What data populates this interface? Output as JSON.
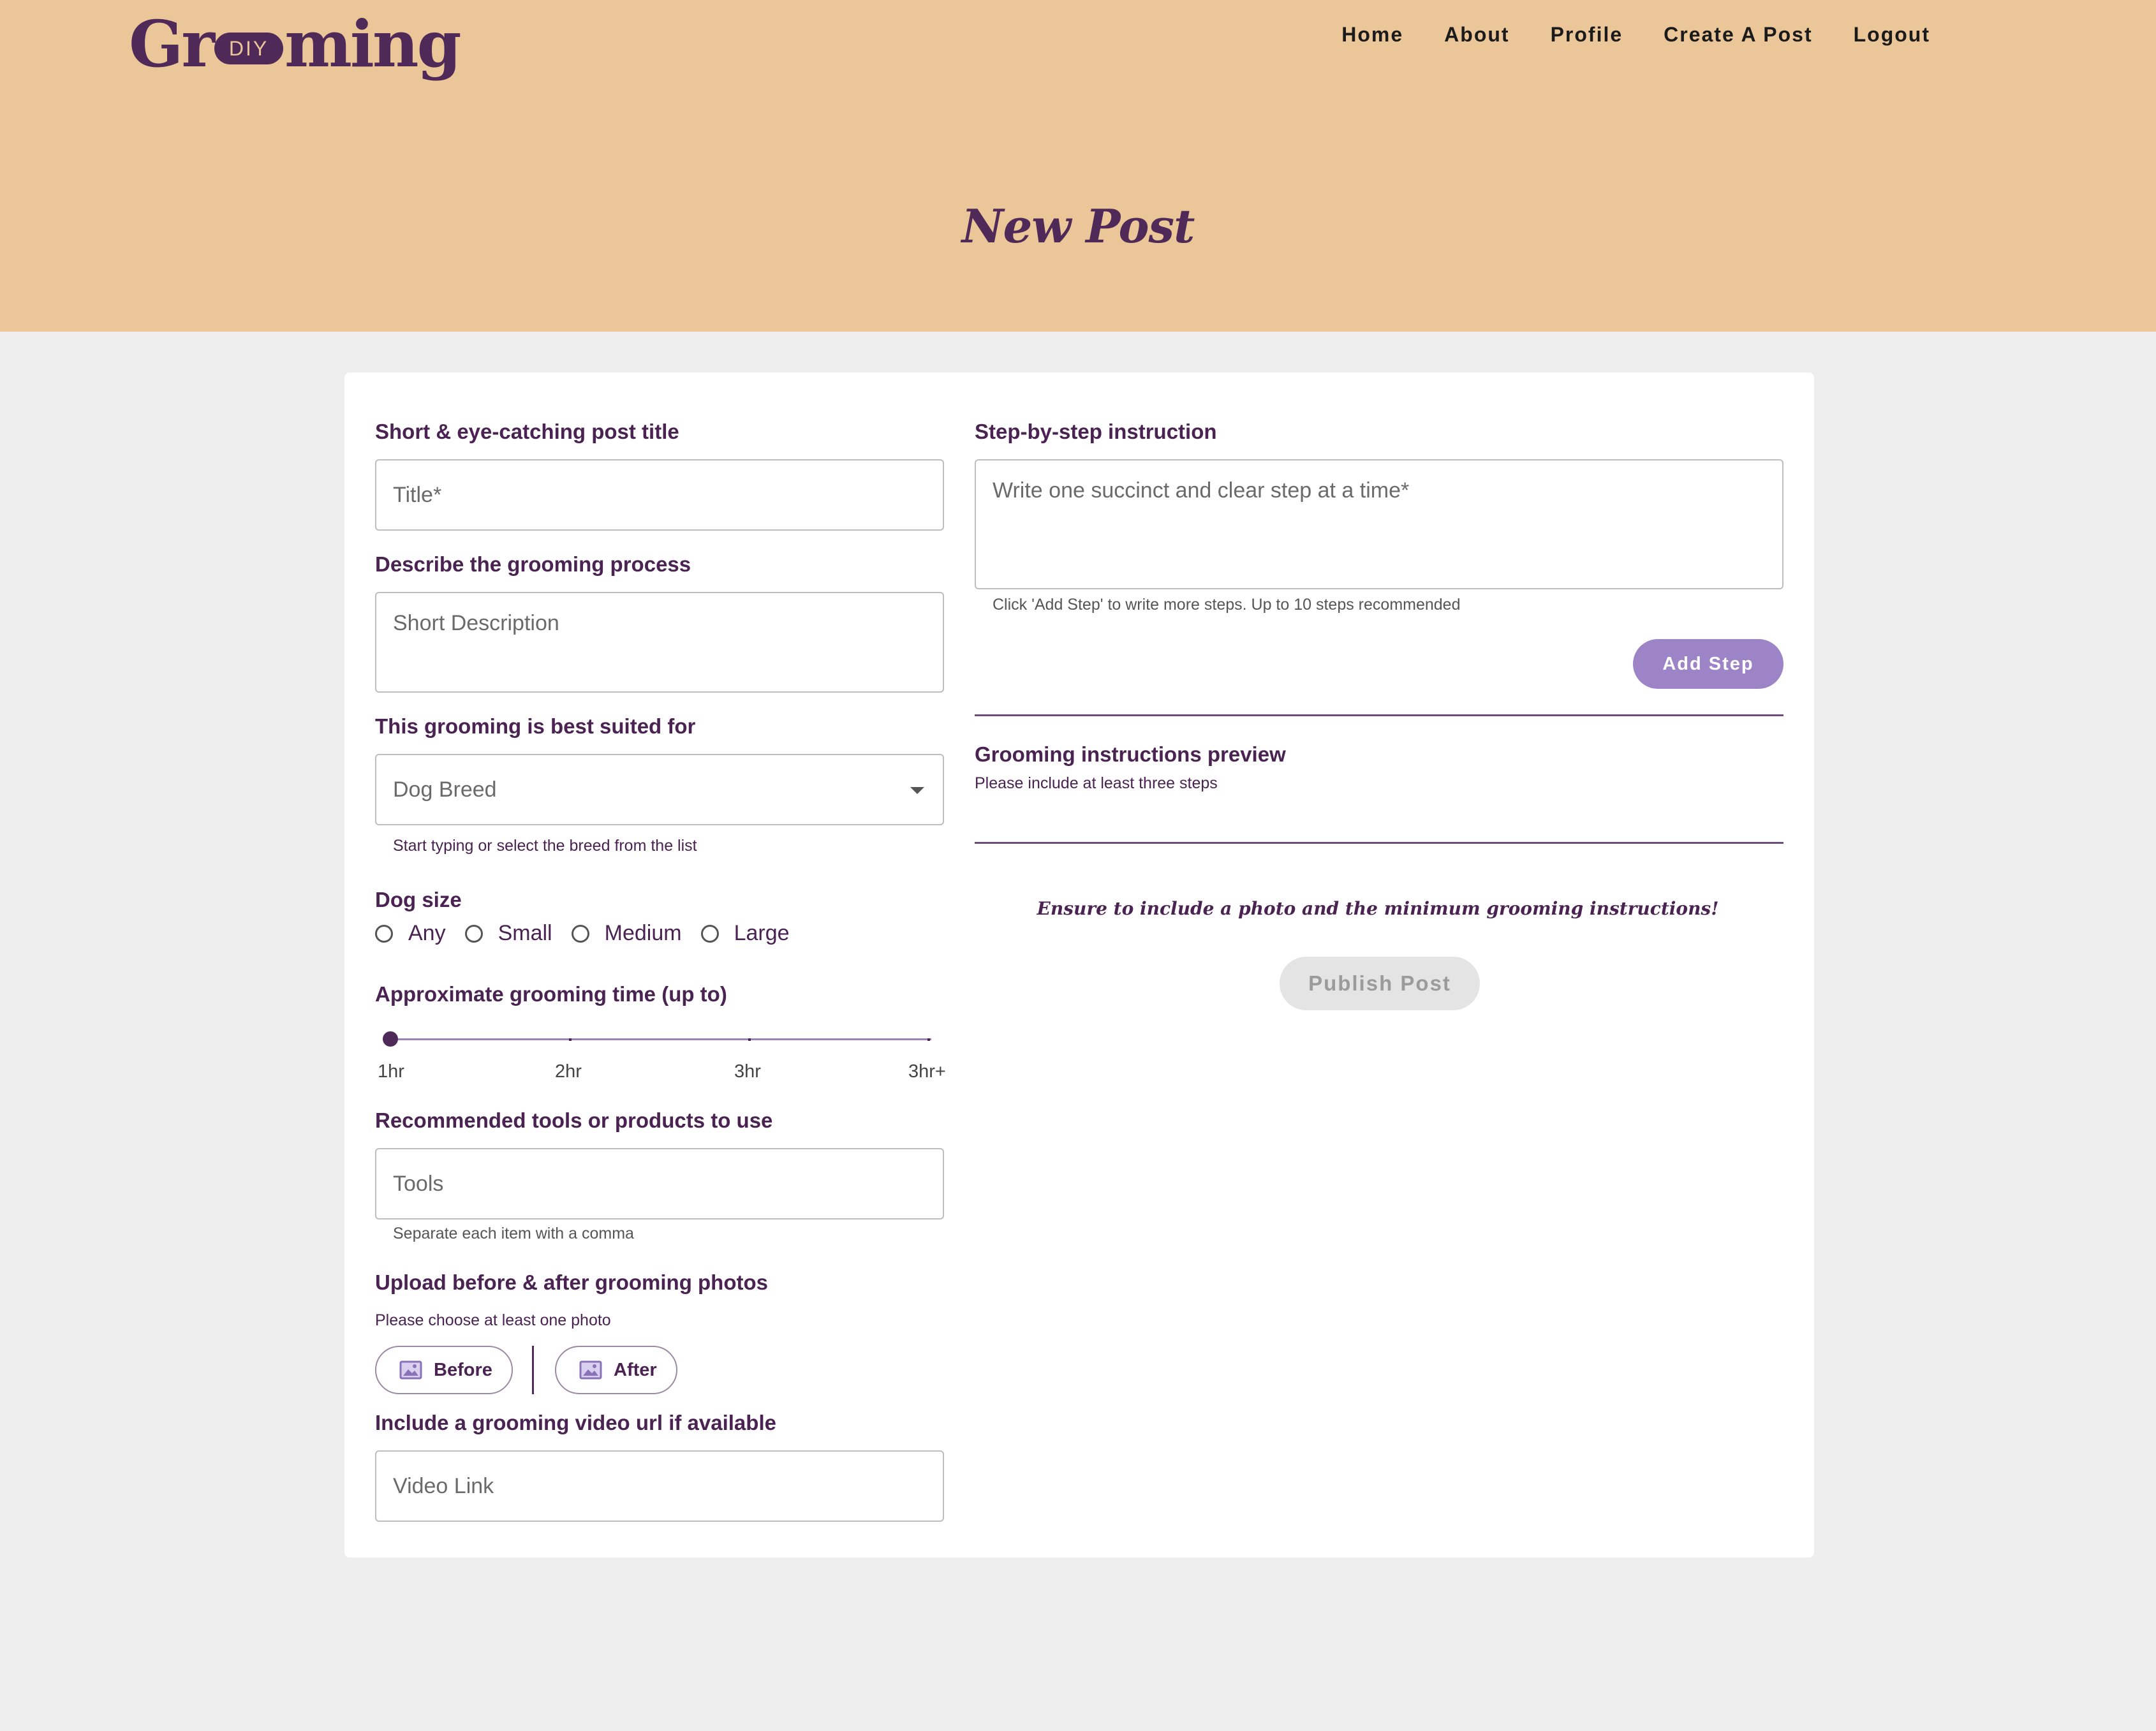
{
  "brand": {
    "logo_left": "Gr",
    "logo_badge": "DIY",
    "logo_right": "ming"
  },
  "nav": [
    "Home",
    "About",
    "Profile",
    "Create A Post",
    "Logout"
  ],
  "page_title": "New Post",
  "form": {
    "title_label": "Short & eye-catching post title",
    "title_placeholder": "Title*",
    "description_label": "Describe the grooming process",
    "description_placeholder": "Short Description",
    "breed_label": "This grooming is best suited for",
    "breed_placeholder": "Dog Breed",
    "breed_hint": "Start typing or select the breed from the list",
    "size_label": "Dog size",
    "size_options": [
      "Any",
      "Small",
      "Medium",
      "Large"
    ],
    "time_label": "Approximate grooming time (up to)",
    "time_options": [
      "1hr",
      "2hr",
      "3hr",
      "3hr+"
    ],
    "time_selected_index": 0,
    "tools_label": "Recommended tools or products to use",
    "tools_placeholder": "Tools",
    "tools_hint": "Separate each item with a comma",
    "photos_label": "Upload before & after grooming photos",
    "photos_hint": "Please choose at least one photo",
    "before_label": "Before",
    "after_label": "After",
    "video_label": "Include a grooming video url if available",
    "video_placeholder": "Video Link",
    "steps_label": "Step-by-step instruction",
    "steps_placeholder": "Write one succinct and clear step at a time*",
    "steps_hint": "Click 'Add Step' to write more steps. Up to 10 steps recommended",
    "add_step_label": "Add Step",
    "preview_label": "Grooming instructions preview",
    "preview_hint": "Please include at least three steps",
    "warning": "Ensure to include a photo and the minimum grooming instructions!",
    "publish_label": "Publish Post"
  },
  "colors": {
    "header_bg": "#ebc698",
    "primary": "#4f2a58",
    "accent": "#9d84c7",
    "page_bg": "#eeeeee"
  },
  "icons": {
    "photo": "image-icon",
    "dropdown": "caret-down-icon"
  }
}
